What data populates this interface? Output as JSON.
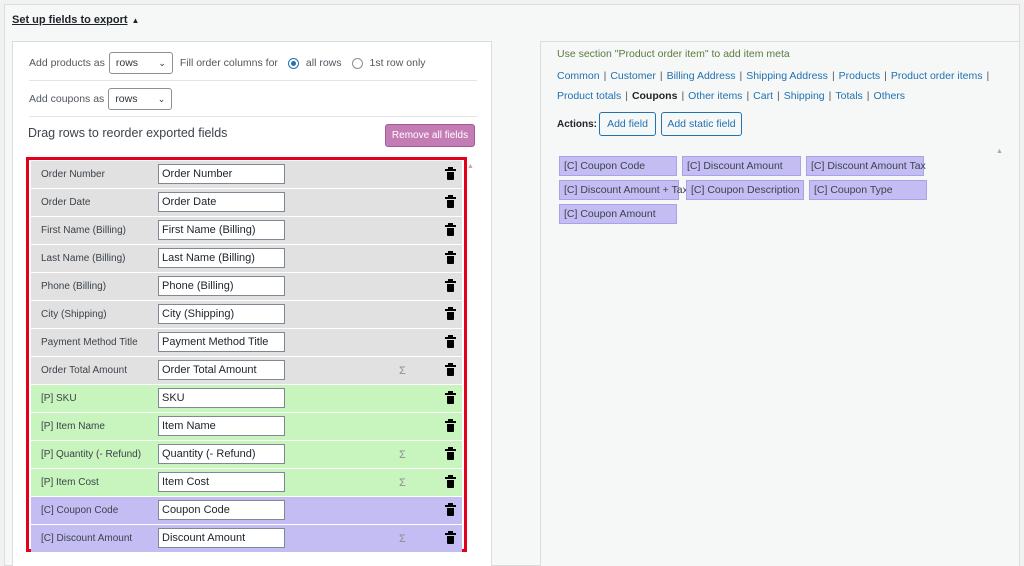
{
  "section_toggle": {
    "label": "Set up fields to export",
    "arrow": "▲"
  },
  "options": {
    "add_products_label": "Add products as",
    "add_products_value": "rows",
    "fill_columns_label": "Fill order columns for",
    "fill_all_rows": "all rows",
    "fill_first_row": "1st row only",
    "fill_selected": "all rows",
    "add_coupons_label": "Add coupons as",
    "add_coupons_value": "rows"
  },
  "drag_title": "Drag rows to reorder exported fields",
  "remove_all_label": "Remove all fields",
  "colors": {
    "gray_row": "#e1e1e1",
    "product_row": "#c8f5bd",
    "coupon_row": "#c3bdf3",
    "highlight_border": "#e2001a",
    "remove_button": "#c47cb5"
  },
  "fields": [
    {
      "label": "Order Number",
      "value": "Order Number",
      "sigma": "",
      "type": "gray"
    },
    {
      "label": "Order Date",
      "value": "Order Date",
      "sigma": "",
      "type": "gray"
    },
    {
      "label": "First Name (Billing)",
      "value": "First Name (Billing)",
      "sigma": "",
      "type": "gray"
    },
    {
      "label": "Last Name (Billing)",
      "value": "Last Name (Billing)",
      "sigma": "",
      "type": "gray"
    },
    {
      "label": "Phone (Billing)",
      "value": "Phone (Billing)",
      "sigma": "",
      "type": "gray"
    },
    {
      "label": "City (Shipping)",
      "value": "City (Shipping)",
      "sigma": "",
      "type": "gray"
    },
    {
      "label": "Payment Method Title",
      "value": "Payment Method Title",
      "sigma": "",
      "type": "gray"
    },
    {
      "label": "Order Total Amount",
      "value": "Order Total Amount",
      "sigma": "Σ",
      "type": "gray"
    },
    {
      "label": "[P] SKU",
      "value": "SKU",
      "sigma": "",
      "type": "green"
    },
    {
      "label": "[P] Item Name",
      "value": "Item Name",
      "sigma": "",
      "type": "green"
    },
    {
      "label": "[P] Quantity (- Refund)",
      "value": "Quantity (- Refund)",
      "sigma": "Σ",
      "type": "green"
    },
    {
      "label": "[P] Item Cost",
      "value": "Item Cost",
      "sigma": "Σ",
      "type": "green"
    },
    {
      "label": "[C] Coupon Code",
      "value": "Coupon Code",
      "sigma": "",
      "type": "purple"
    },
    {
      "label": "[C] Discount Amount",
      "value": "Discount Amount",
      "sigma": "Σ",
      "type": "purple"
    }
  ],
  "right": {
    "hint": "Use section \"Product order item\" to add item meta",
    "tabs_line1": [
      "Common",
      "Customer",
      "Billing Address",
      "Shipping Address",
      "Products",
      "Product order items"
    ],
    "tabs_line2": [
      "Product totals",
      "Coupons",
      "Other items",
      "Cart",
      "Shipping",
      "Totals",
      "Others"
    ],
    "active_tab": "Coupons",
    "actions_label": "Actions:",
    "add_field": "Add field",
    "add_static_field": "Add static field",
    "chips": [
      "[C] Coupon Code",
      "[C] Discount Amount",
      "[C] Discount Amount Tax",
      "[C] Discount Amount + Tax",
      "[C] Coupon Description",
      "[C] Coupon Type",
      "[C] Coupon Amount"
    ]
  }
}
